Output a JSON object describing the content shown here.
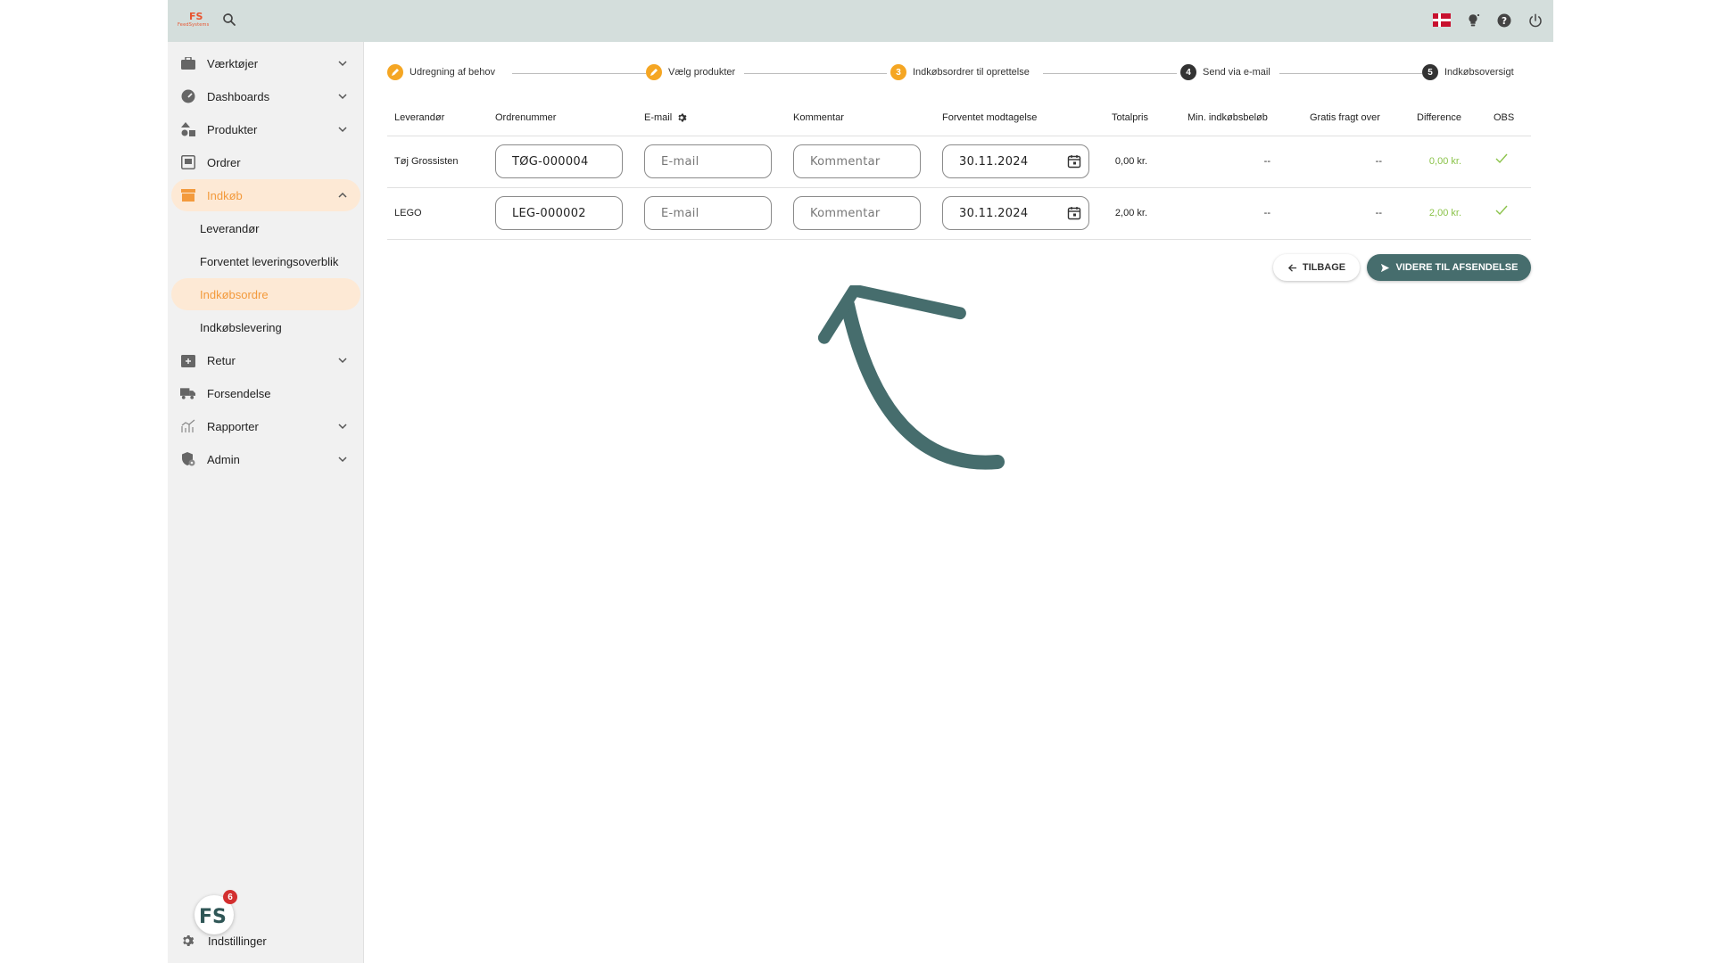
{
  "topbar": {
    "logo_mark": "FS",
    "logo_word": "FeedSystems"
  },
  "sidebar": {
    "items": [
      {
        "label": "Værktøjer",
        "icon": "toolbox-icon"
      },
      {
        "label": "Dashboards",
        "icon": "speedometer-icon"
      },
      {
        "label": "Produkter",
        "icon": "shapes-icon"
      },
      {
        "label": "Ordrer",
        "icon": "inbox-icon"
      },
      {
        "label": "Indkøb",
        "icon": "store-icon"
      },
      {
        "label": "Retur",
        "icon": "return-box-icon"
      },
      {
        "label": "Forsendelse",
        "icon": "truck-icon"
      },
      {
        "label": "Rapporter",
        "icon": "chart-icon"
      },
      {
        "label": "Admin",
        "icon": "shield-gear-icon"
      }
    ],
    "subitems": [
      {
        "label": "Leverandør"
      },
      {
        "label": "Forventet leveringsoverblik"
      },
      {
        "label": "Indkøbsordre"
      },
      {
        "label": "Indkøbslevering"
      }
    ],
    "settings_label": "Indstillinger",
    "fab_badge": "6",
    "fab_label": "FS"
  },
  "stepper": {
    "steps": [
      {
        "label": "Udregning af behov",
        "marker": ""
      },
      {
        "label": "Vælg produkter",
        "marker": ""
      },
      {
        "label": "Indkøbsordrer til oprettelse",
        "marker": "3"
      },
      {
        "label": "Send via e-mail",
        "marker": "4"
      },
      {
        "label": "Indkøbsoversigt",
        "marker": "5"
      }
    ]
  },
  "table": {
    "headers": [
      "Leverandør",
      "Ordrenummer",
      "E-mail",
      "Kommentar",
      "Forventet modtagelse",
      "Totalpris",
      "Min. indkøbsbeløb",
      "Gratis fragt over",
      "Difference",
      "OBS"
    ],
    "rows": [
      {
        "supplier": "Tøj Grossisten",
        "order_number": "TØG-000004",
        "email_placeholder": "E-mail",
        "comment_placeholder": "Kommentar",
        "date": "30.11.2024",
        "total": "0,00 kr.",
        "min": "--",
        "free_shipping": "--",
        "difference": "0,00 kr."
      },
      {
        "supplier": "LEGO",
        "order_number": "LEG-000002",
        "email_placeholder": "E-mail",
        "comment_placeholder": "Kommentar",
        "date": "30.11.2024",
        "total": "2,00 kr.",
        "min": "--",
        "free_shipping": "--",
        "difference": "2,00 kr."
      }
    ]
  },
  "actions": {
    "back_label": "TILBAGE",
    "next_label": "VIDERE TIL AFSENDELSE"
  },
  "colors": {
    "accent_orange": "#f5a623",
    "primary_teal": "#466d6d",
    "success_green": "#8bc34a",
    "topbar_bg": "#d4dedc"
  }
}
